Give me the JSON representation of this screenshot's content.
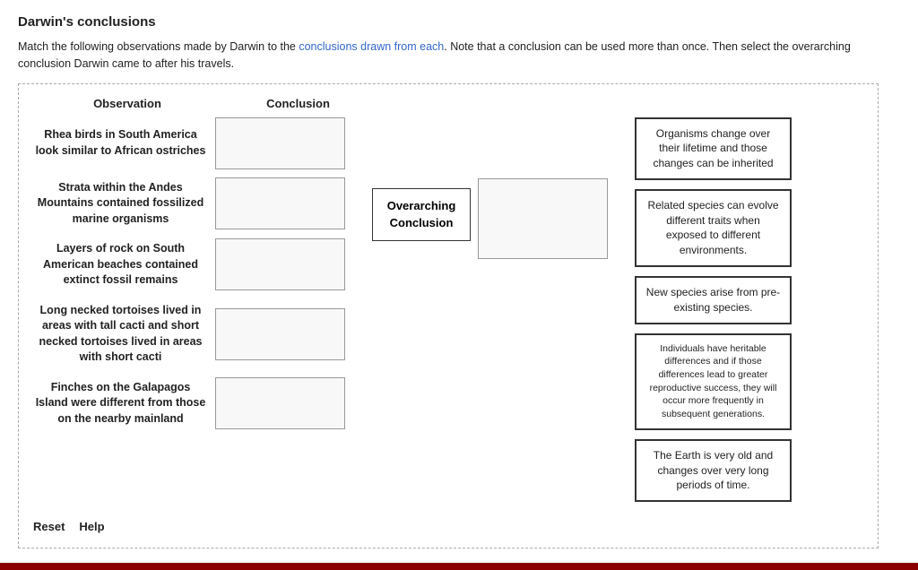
{
  "page": {
    "title": "Darwin's conclusions",
    "instructions_text": "Match the following observations made by Darwin to the ",
    "instructions_link": "conclusions drawn from each",
    "instructions_suffix": ". Note that a conclusion can be used more than once. Then select the overarching conclusion Darwin came to after his travels.",
    "col_observation": "Observation",
    "col_conclusion": "Conclusion"
  },
  "observations": [
    {
      "id": 1,
      "text": "Rhea birds in South America look similar to African ostriches"
    },
    {
      "id": 2,
      "text": "Strata within the Andes Mountains contained fossilized marine organisms"
    },
    {
      "id": 3,
      "text": "Layers of rock on South American beaches contained extinct fossil remains"
    },
    {
      "id": 4,
      "text": "Long necked tortoises lived in areas with tall cacti and short necked tortoises lived in areas with short cacti"
    },
    {
      "id": 5,
      "text": "Finches on the Galapagos Island were different from those on the nearby mainland"
    }
  ],
  "answer_options": [
    {
      "id": 1,
      "text": "Organisms change over their lifetime and those changes can be inherited",
      "small": false
    },
    {
      "id": 2,
      "text": "Related species can evolve different traits when exposed to different environments.",
      "small": false
    },
    {
      "id": 3,
      "text": "New species arise from pre-existing species.",
      "small": false
    },
    {
      "id": 4,
      "text": "Individuals have heritable differences and if those differences lead to greater reproductive success, they will occur more frequently in subsequent generations.",
      "small": true
    },
    {
      "id": 5,
      "text": "The Earth is very old and changes over very long periods of time.",
      "small": false
    }
  ],
  "overarching": {
    "label": "Overarching\nConclusion"
  },
  "footer": {
    "reset_label": "Reset",
    "help_label": "Help"
  }
}
